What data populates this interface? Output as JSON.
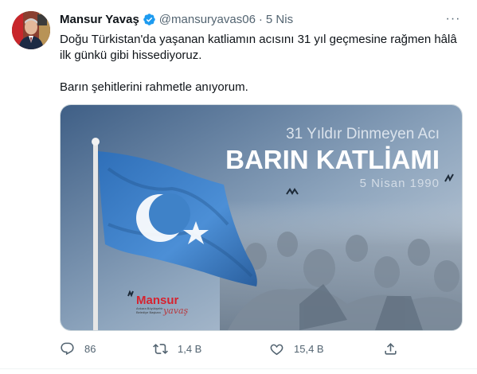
{
  "tweet": {
    "author_name": "Mansur Yavaş",
    "handle": "@mansuryavas06",
    "separator": "·",
    "timestamp": "5 Nis",
    "more_label": "···",
    "text_line1": "Doğu Türkistan'da yaşanan katliamın acısını 31 yıl geçmesine rağmen hâlâ ilk günkü gibi hissediyoruz.",
    "text_line2": "Barın şehitlerini rahmetle anıyorum."
  },
  "media": {
    "subtitle": "31 Yıldır Dinmeyen Acı",
    "title": "BARIN KATLİAMI",
    "date": "5 Nisan 1990",
    "logo_name": "Mansur",
    "logo_script": "yavaş",
    "logo_caption_1": "Ankara Büyükşehir",
    "logo_caption_2": "Belediye Başkanı"
  },
  "actions": {
    "replies": "86",
    "retweets": "1,4 B",
    "likes": "15,4 B"
  },
  "colors": {
    "verified": "#1d9bf0",
    "flag_blue": "#4a90d9",
    "logo_red": "#d6232f",
    "muted": "#536471"
  }
}
